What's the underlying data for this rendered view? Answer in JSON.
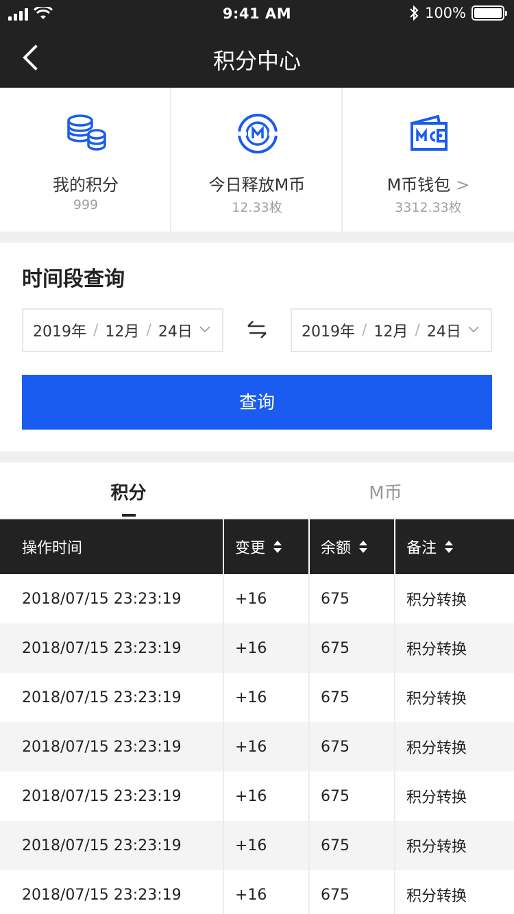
{
  "status_bar": {
    "time": "9:41 AM",
    "battery": "100%"
  },
  "nav": {
    "title": "积分中心"
  },
  "summary": [
    {
      "label": "我的积分",
      "value": "999",
      "icon": "coins-icon"
    },
    {
      "label": "今日释放M币",
      "value": "12.33枚",
      "icon": "m-coin-icon"
    },
    {
      "label": "M币钱包",
      "value": "3312.33枚",
      "icon": "wallet-icon",
      "chevron": ">"
    }
  ],
  "query": {
    "heading": "时间段查询",
    "start": {
      "year": "2019年",
      "month": "12月",
      "day": "24日",
      "sep": "/"
    },
    "end": {
      "year": "2019年",
      "month": "12月",
      "day": "24日",
      "sep": "/"
    },
    "button": "查询"
  },
  "tabs": [
    {
      "label": "积分",
      "active": true
    },
    {
      "label": "M币",
      "active": false
    }
  ],
  "table": {
    "headers": [
      "操作时间",
      "变更",
      "余额",
      "备注"
    ],
    "rows": [
      [
        "2018/07/15 23:23:19",
        "+16",
        "675",
        "积分转换"
      ],
      [
        "2018/07/15 23:23:19",
        "+16",
        "675",
        "积分转换"
      ],
      [
        "2018/07/15 23:23:19",
        "+16",
        "675",
        "积分转换"
      ],
      [
        "2018/07/15 23:23:19",
        "+16",
        "675",
        "积分转换"
      ],
      [
        "2018/07/15 23:23:19",
        "+16",
        "675",
        "积分转换"
      ],
      [
        "2018/07/15 23:23:19",
        "+16",
        "675",
        "积分转换"
      ],
      [
        "2018/07/15 23:23:19",
        "+16",
        "675",
        "积分转换"
      ]
    ]
  },
  "colors": {
    "primary": "#1a5cef",
    "header_bg": "#222222",
    "alt_row": "#f4f4f4"
  }
}
